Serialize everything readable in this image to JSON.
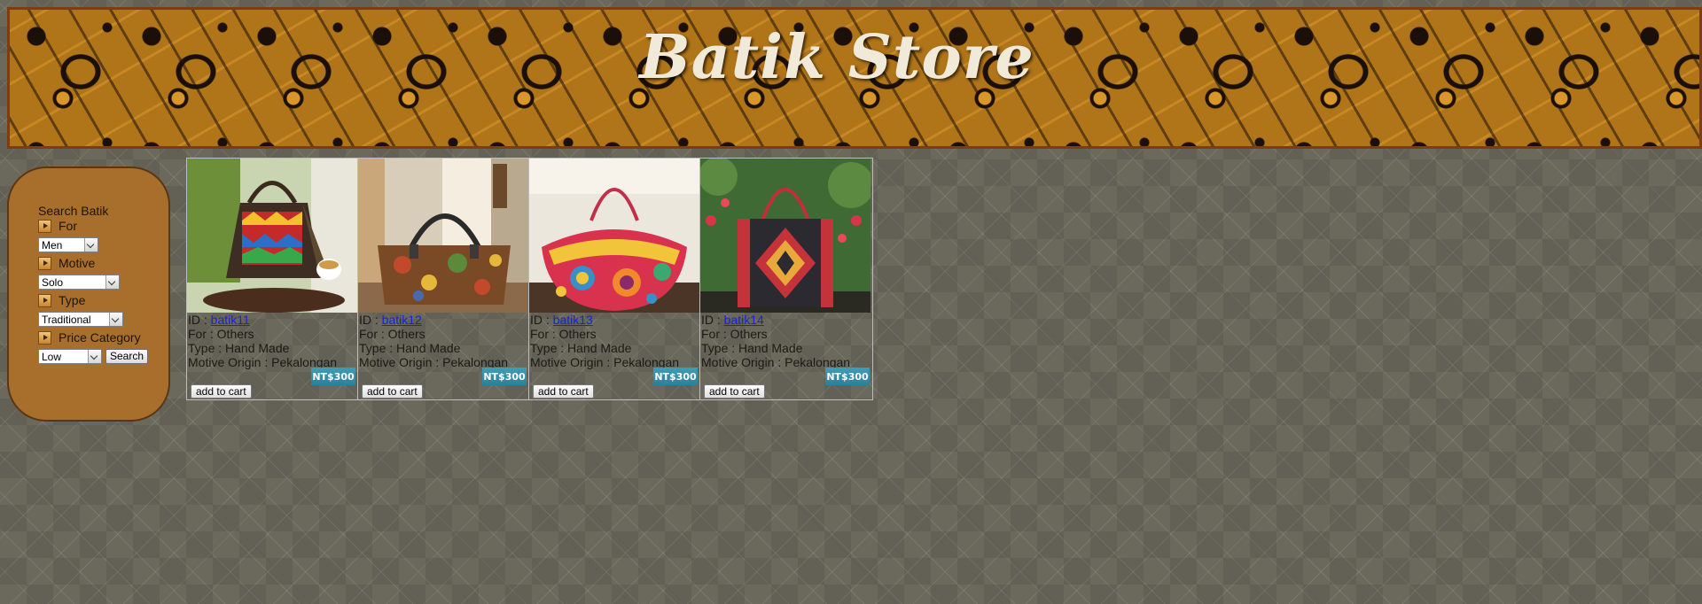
{
  "header": {
    "title": "Batik Store"
  },
  "search": {
    "title": "Search Batik",
    "for_label": "For",
    "for_value": "Men",
    "motive_label": "Motive",
    "motive_value": "Solo",
    "type_label": "Type",
    "type_value": "Traditional",
    "price_label": "Price Category",
    "price_value": "Low",
    "search_button": "Search"
  },
  "products": [
    {
      "id_label": "ID : ",
      "id": "batik11",
      "for": "For : Others",
      "type": "Type : Hand Made",
      "origin": "Motive Origin : Pekalongan",
      "price": "NT$300",
      "cart": "add to cart"
    },
    {
      "id_label": "ID : ",
      "id": "batik12",
      "for": "For : Others",
      "type": "Type : Hand Made",
      "origin": "Motive Origin : Pekalongan",
      "price": "NT$300",
      "cart": "add to cart"
    },
    {
      "id_label": "ID : ",
      "id": "batik13",
      "for": "For : Others",
      "type": "Type : Hand Made",
      "origin": "Motive Origin : Pekalongan",
      "price": "NT$300",
      "cart": "add to cart"
    },
    {
      "id_label": "ID : ",
      "id": "batik14",
      "for": "For : Others",
      "type": "Type : Hand Made",
      "origin": "Motive Origin : Pekalongan",
      "price": "NT$300",
      "cart": "add to cart"
    }
  ],
  "colors": {
    "banner_bg": "#b07419",
    "sidebar_bg": "#a86f2c",
    "price_badge": "#3a94b0",
    "link": "#1a22d8",
    "page_bg": "#6b685c"
  }
}
